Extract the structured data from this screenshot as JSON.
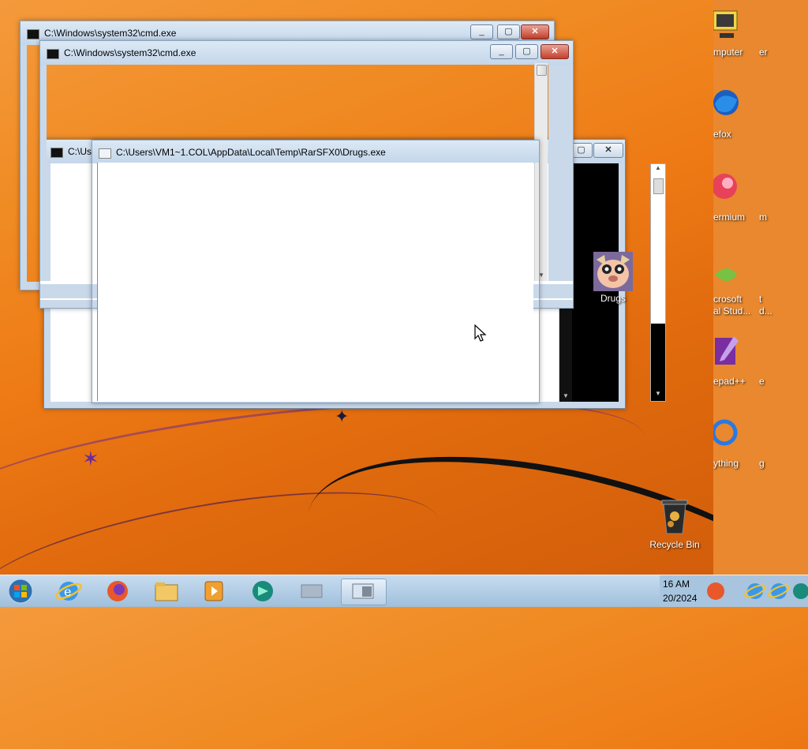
{
  "windows": {
    "cmd_back": {
      "title": "C:\\Windows\\system32\\cmd.exe"
    },
    "cmd_front": {
      "title": "C:\\Windows\\system32\\cmd.exe"
    },
    "cmd_partial": {
      "title": "C:\\Us"
    },
    "drugs_exe": {
      "title": "C:\\Users\\VM1~1.COL\\AppData\\Local\\Temp\\RarSFX0\\Drugs.exe"
    }
  },
  "desktop_icons": [
    {
      "id": "drugs",
      "label": "Drugs",
      "icon": "dog-face-icon"
    },
    {
      "id": "recycle",
      "label": "Recycle Bin",
      "icon": "recycle-bin-icon"
    }
  ],
  "right_strip_labels": [
    "mputer",
    "efox",
    "ermium",
    "crosoft",
    "al Stud...",
    "epad++",
    "ything"
  ],
  "right_strip_labels2": [
    "er",
    "m",
    "t",
    "d...",
    "e",
    "g"
  ],
  "taskbar": {
    "items": [
      "start-orb-icon",
      "internet-explorer-icon",
      "firefox-icon",
      "explorer-folder-icon",
      "media-player-icon",
      "app-green-icon",
      "blank-window-icon",
      "active-window-icon"
    ],
    "clock_time": "16 AM",
    "clock_date": "20/2024"
  },
  "colors": {
    "accent": "#f08a22",
    "taskbar": "#b8d0e8"
  }
}
